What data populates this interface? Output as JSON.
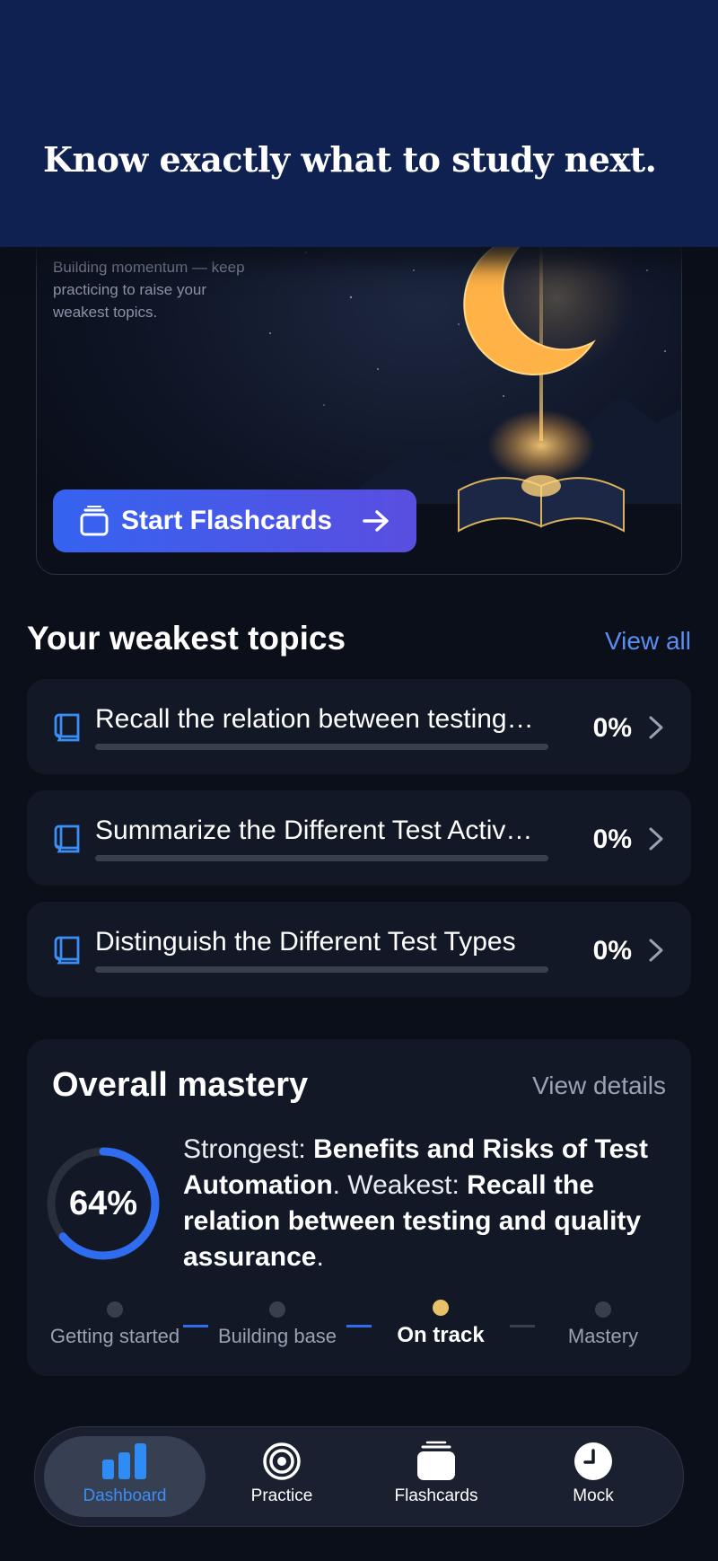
{
  "header": {
    "title": "Know exactly what to study next."
  },
  "hero": {
    "status_text": "Building momentum — keep practicing to raise your weakest topics.",
    "cta_label": "Start Flashcards"
  },
  "weakest": {
    "title": "Your weakest topics",
    "view_all": "View all",
    "items": [
      {
        "label": "Recall the relation between testing…",
        "percent": "0%",
        "progress": 0
      },
      {
        "label": "Summarize the Different Test Activ…",
        "percent": "0%",
        "progress": 0
      },
      {
        "label": "Distinguish the Different Test Types",
        "percent": "0%",
        "progress": 0
      }
    ]
  },
  "mastery": {
    "title": "Overall mastery",
    "view_details": "View details",
    "percent": "64%",
    "progress": 0.64,
    "strongest_prefix": "Strongest: ",
    "strongest": "Benefits and Risks of Test Automation",
    "weakest_prefix": ". Weakest: ",
    "weakest": "Recall the relation between testing and quality assurance",
    "suffix": ".",
    "stages": [
      "Getting started",
      "Building base",
      "On track",
      "Mastery"
    ],
    "active_stage": "On track"
  },
  "nav": {
    "items": [
      {
        "label": "Dashboard",
        "icon": "bar-chart-icon",
        "active": true
      },
      {
        "label": "Practice",
        "icon": "target-icon",
        "active": false
      },
      {
        "label": "Flashcards",
        "icon": "cards-icon",
        "active": false
      },
      {
        "label": "Mock",
        "icon": "clock-icon",
        "active": false
      }
    ]
  },
  "colors": {
    "accent": "#5b8ef0",
    "header": "#0f2150",
    "cta_start": "#3563f0",
    "cta_end": "#5a4ee0",
    "active_stage": "#e8c168",
    "nav_active": "#3a8ef5"
  }
}
